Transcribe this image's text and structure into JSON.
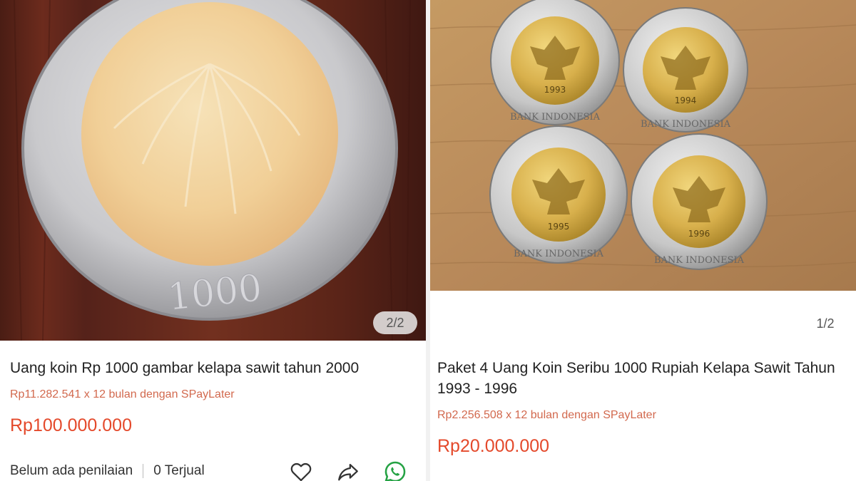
{
  "products": [
    {
      "image_counter": "2/2",
      "title": "Uang koin Rp 1000 gambar kelapa sawit tahun 2000",
      "installment": "Rp11.282.541 x 12 bulan dengan SPayLater",
      "price": "Rp100.000.000",
      "rating_status": "Belum ada penilaian",
      "sold": "0 Terjual",
      "coin_value": "1000",
      "actions": [
        "heart-icon",
        "share-icon",
        "whatsapp-icon"
      ]
    },
    {
      "image_counter": "1/2",
      "title": "Paket 4 Uang Koin Seribu 1000 Rupiah Kelapa Sawit Tahun 1993 - 1996",
      "installment": "Rp2.256.508 x 12 bulan dengan SPayLater",
      "price": "Rp20.000.000",
      "coin_text": "BANK INDONESIA",
      "coin_years": [
        "1993",
        "1994",
        "1995",
        "1996"
      ]
    }
  ],
  "colors": {
    "price": "#e4492b",
    "installment": "#d2694e",
    "whatsapp": "#25a244"
  }
}
